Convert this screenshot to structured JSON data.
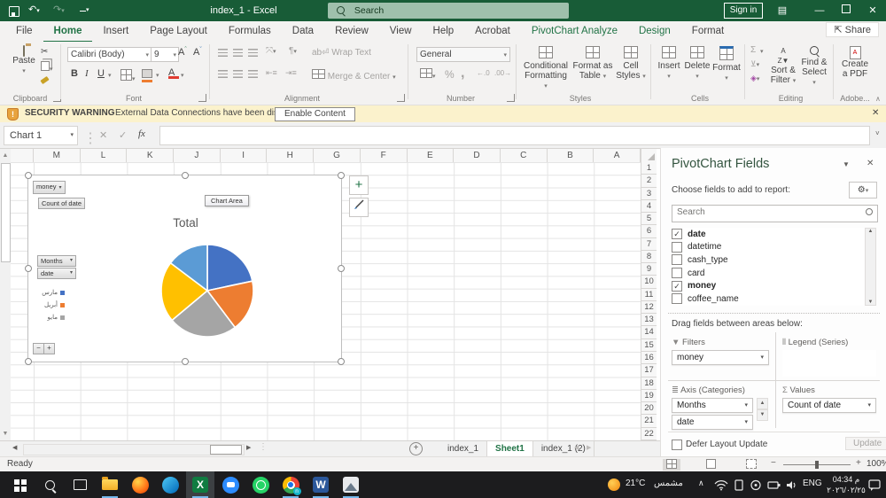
{
  "colors": {
    "excel_green": "#185C37",
    "accent_green": "#217346",
    "warning_bg": "#FBF2CC",
    "taskbar_underline": "#76B9ED"
  },
  "titlebar": {
    "title": "index_1 - Excel",
    "search_placeholder": "Search",
    "sign_in": "Sign in"
  },
  "ribbon": {
    "tabs": [
      {
        "label": "File"
      },
      {
        "label": "Home",
        "active": true
      },
      {
        "label": "Insert"
      },
      {
        "label": "Page Layout"
      },
      {
        "label": "Formulas"
      },
      {
        "label": "Data"
      },
      {
        "label": "Review"
      },
      {
        "label": "View"
      },
      {
        "label": "Help"
      },
      {
        "label": "Acrobat"
      },
      {
        "label": "PivotChart Analyze",
        "contextual": true
      },
      {
        "label": "Design",
        "contextual": true
      },
      {
        "label": "Format"
      }
    ],
    "share": "Share",
    "clipboard": {
      "group": "Clipboard",
      "paste": "Paste"
    },
    "font": {
      "group": "Font",
      "name": "Calibri (Body)",
      "size": "9",
      "bold": "B",
      "italic": "I",
      "underline": "U"
    },
    "alignment": {
      "group": "Alignment",
      "wrap": "Wrap Text",
      "merge": "Merge & Center"
    },
    "number": {
      "group": "Number",
      "format": "General",
      "percent": "%",
      "comma": ",",
      "dec_inc": "←.0",
      "dec_dec": ".00→"
    },
    "styles": {
      "group": "Styles",
      "cond1": "Conditional",
      "cond2": "Formatting",
      "fat1": "Format as",
      "fat2": "Table",
      "cs1": "Cell",
      "cs2": "Styles"
    },
    "cells": {
      "group": "Cells",
      "insert": "Insert",
      "delete": "Delete",
      "format": "Format"
    },
    "editing": {
      "group": "Editing",
      "sigma": "Σ",
      "sort1": "Sort &",
      "sort2": "Filter",
      "find1": "Find &",
      "find2": "Select"
    },
    "adobe": {
      "group": "Adobe...",
      "pdf1": "Create",
      "pdf2": "a PDF"
    }
  },
  "warning": {
    "label": "SECURITY WARNING",
    "message": "External Data Connections have been disabled",
    "button": "Enable Content"
  },
  "formula_bar": {
    "name_box": "Chart 1",
    "fx": "fx"
  },
  "worksheet": {
    "columns": [
      "M",
      "L",
      "K",
      "J",
      "I",
      "H",
      "G",
      "F",
      "E",
      "D",
      "C",
      "B",
      "A"
    ],
    "rows": [
      "1",
      "2",
      "3",
      "4",
      "5",
      "6",
      "7",
      "8",
      "9",
      "10",
      "11",
      "12",
      "13",
      "14",
      "15",
      "16",
      "17",
      "18",
      "19",
      "20",
      "21",
      "22"
    ]
  },
  "chart": {
    "filter_button": "money",
    "value_button": "Count of date",
    "axis_button_1": "Months",
    "axis_button_2": "date",
    "tooltip": "Chart Area",
    "title": "Total",
    "collapse": "−",
    "expand": "+",
    "legend": [
      {
        "label": "مارس",
        "color": "#4472C4"
      },
      {
        "label": "أبريل",
        "color": "#ED7D31"
      },
      {
        "label": "مايو",
        "color": "#A5A5A5"
      }
    ]
  },
  "chart_data": {
    "type": "pie",
    "title": "Total",
    "legend_position": "left",
    "slices": [
      {
        "label": "مارس",
        "color": "#4472C4",
        "start": 0,
        "end": 78,
        "percent": 21.7
      },
      {
        "label": "أبريل",
        "color": "#ED7D31",
        "start": 78,
        "end": 143,
        "percent": 18.1
      },
      {
        "label": "مايو",
        "color": "#A5A5A5",
        "start": 143,
        "end": 230,
        "percent": 24.2
      },
      {
        "label": "",
        "color": "#FFC000",
        "start": 230,
        "end": 307,
        "percent": 21.4
      },
      {
        "label": "",
        "color": "#5B9BD5",
        "start": 307,
        "end": 360,
        "percent": 14.7
      }
    ]
  },
  "panel": {
    "title": "PivotChart Fields",
    "choose": "Choose fields to add to report:",
    "search_placeholder": "Search",
    "fields": [
      {
        "name": "date",
        "checked": true
      },
      {
        "name": "datetime",
        "checked": false
      },
      {
        "name": "cash_type",
        "checked": false
      },
      {
        "name": "card",
        "checked": false
      },
      {
        "name": "money",
        "checked": true
      },
      {
        "name": "coffee_name",
        "checked": false
      }
    ],
    "drag": "Drag fields between areas below:",
    "filters_label": "Filters",
    "legend_label": "Legend (Series)",
    "axis_label": "Axis (Categories)",
    "values_label": "Values",
    "filters_items": [
      "money"
    ],
    "legend_items": [],
    "axis_items": [
      "Months",
      "date"
    ],
    "values_items": [
      "Count of date"
    ],
    "defer": "Defer Layout Update",
    "update": "Update"
  },
  "sheet_tabs": [
    {
      "label": "index_1"
    },
    {
      "label": "Sheet1",
      "active": true
    },
    {
      "label": "index_1 (2)"
    }
  ],
  "status": {
    "ready": "Ready",
    "zoom": "100%"
  },
  "taskbar": {
    "temp": "21°C",
    "condition": "مشمس",
    "lang": "ENG",
    "time": "04:34 م",
    "date": "٢٠٢٦/٠٢/٢٥",
    "apps": [
      "start",
      "search",
      "task-view",
      "file-explorer",
      "firefox",
      "edge",
      "excel",
      "zoom",
      "whatsapp",
      "chrome",
      "word",
      "photos"
    ],
    "open_apps": [
      "file-explorer",
      "excel",
      "chrome",
      "word",
      "photos"
    ],
    "active_app": "excel"
  }
}
